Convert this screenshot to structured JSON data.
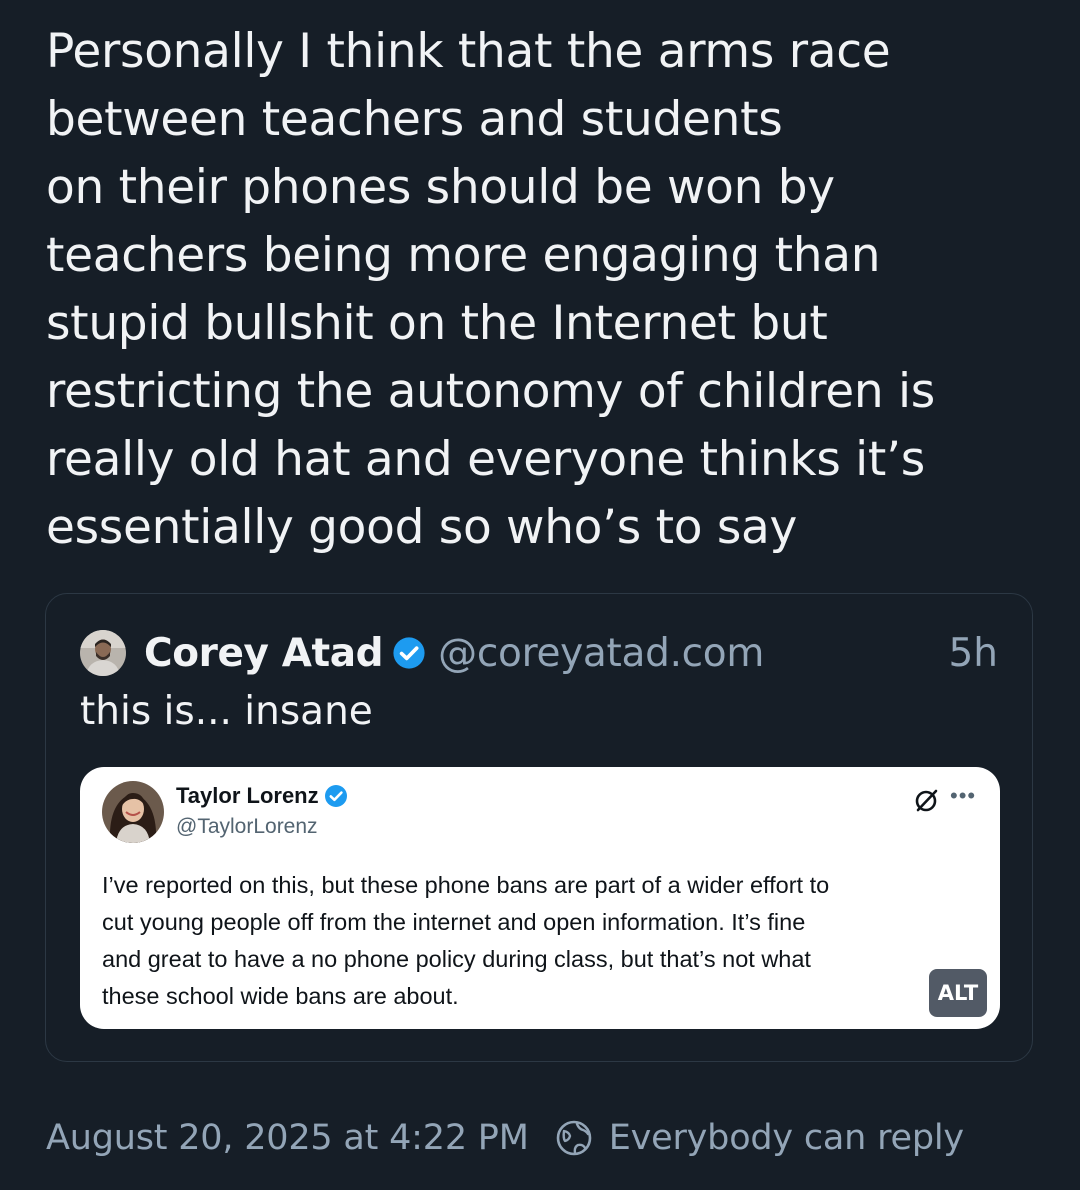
{
  "post": {
    "text_lines": [
      "Personally I think that the arms race",
      "between teachers and students",
      "on their phones should be won by",
      "teachers being more engaging than",
      "stupid bullshit on the Internet but",
      "restricting the autonomy of children is",
      "really old hat and everyone thinks it’s",
      "essentially good so who’s to say"
    ],
    "timestamp": "August 20, 2025 at 4:22 PM",
    "reply_setting": "Everybody can reply"
  },
  "quote": {
    "author_name": "Corey Atad",
    "author_handle": "@coreyatad.com",
    "time_ago": "5h",
    "text": "this is... insane",
    "embedded_image": {
      "author_name": "Taylor Lorenz",
      "author_handle": "@TaylorLorenz",
      "body_lines": [
        "I’ve reported on this, but these phone bans are part of a wider effort to",
        "cut young people off from the internet and open information. It’s fine",
        "and great to have a no phone policy during class, but that’s not what",
        "these school wide bans are about."
      ],
      "more_label": "•••",
      "alt_label": "ALT"
    }
  },
  "colors": {
    "background": "#161e27",
    "text_primary": "#f1f3f5",
    "text_secondary": "#93a5b7",
    "verified_blue": "#1d9bf0",
    "card_border": "#2c3844"
  },
  "icons": [
    "verified-badge-icon",
    "grok-icon",
    "more-icon",
    "globe-icon"
  ]
}
